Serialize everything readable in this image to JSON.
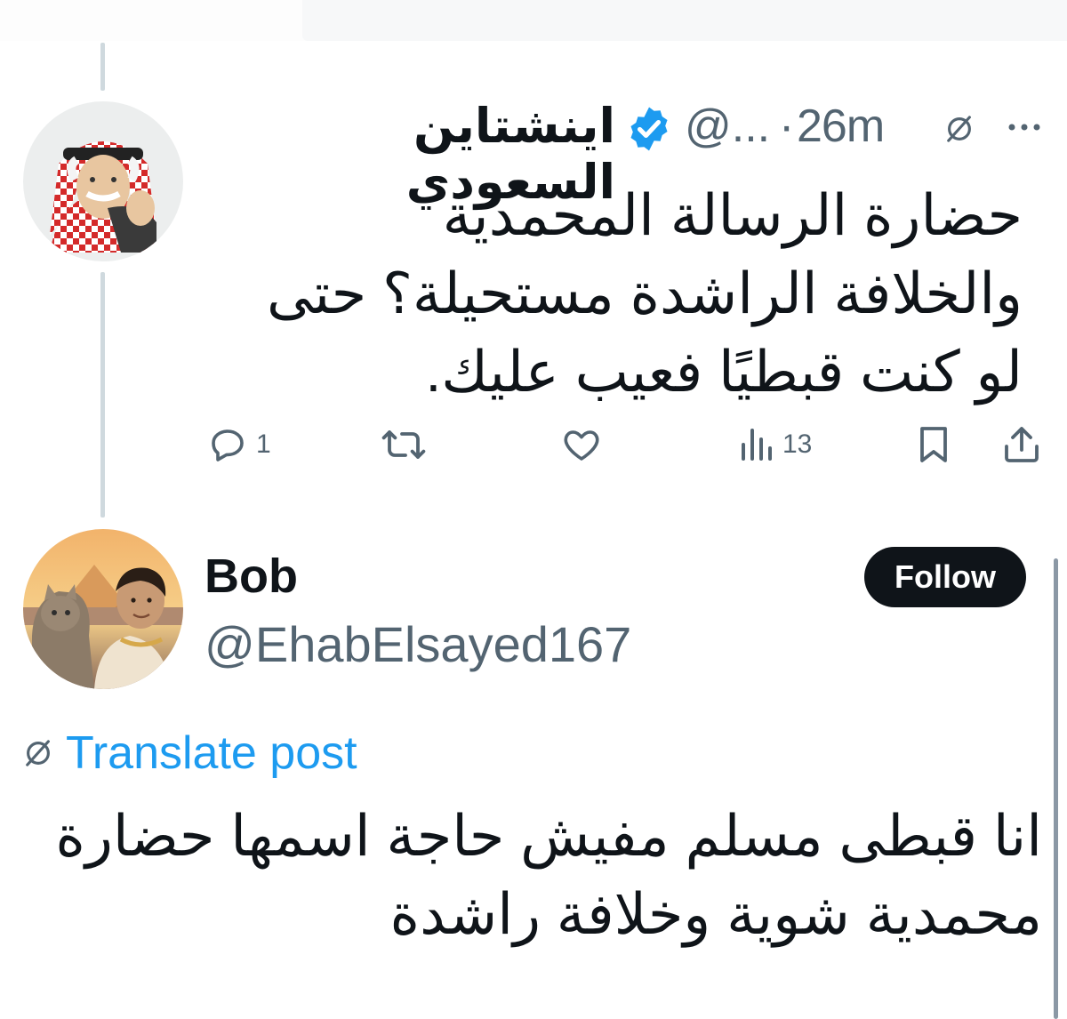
{
  "tweet": {
    "author_name": "اينشتاين السعودي",
    "handle": "@...",
    "separator": "·",
    "time": "26m",
    "text_lines": [
      "حضارة الرسالة المحمدية",
      "والخلافة الراشدة مستحيلة؟  حتى",
      "لو كنت قبطيًا فعيب عليك."
    ],
    "actions": {
      "replies": "1",
      "reposts": "",
      "likes": "",
      "views": "13"
    }
  },
  "reply": {
    "author_name": "Bob",
    "handle": "@EhabElsayed167",
    "follow_label": "Follow",
    "translate_label": "Translate post",
    "text_lines": [
      "انا قبطى مسلم مفيش حاجة اسمها حضارة",
      "محمدية شوية وخلافة راشدة"
    ]
  },
  "colors": {
    "text": "#0f1419",
    "secondary": "#536471",
    "accent": "#1d9bf0",
    "verified": "#1d9bf0",
    "thread_line": "#cfd9de"
  },
  "icons": {
    "verified": "verified-badge-icon",
    "grok": "grok-icon",
    "more": "more-icon",
    "reply": "reply-icon",
    "repost": "repost-icon",
    "like": "like-icon",
    "views": "views-icon",
    "bookmark": "bookmark-icon",
    "share": "share-icon"
  }
}
